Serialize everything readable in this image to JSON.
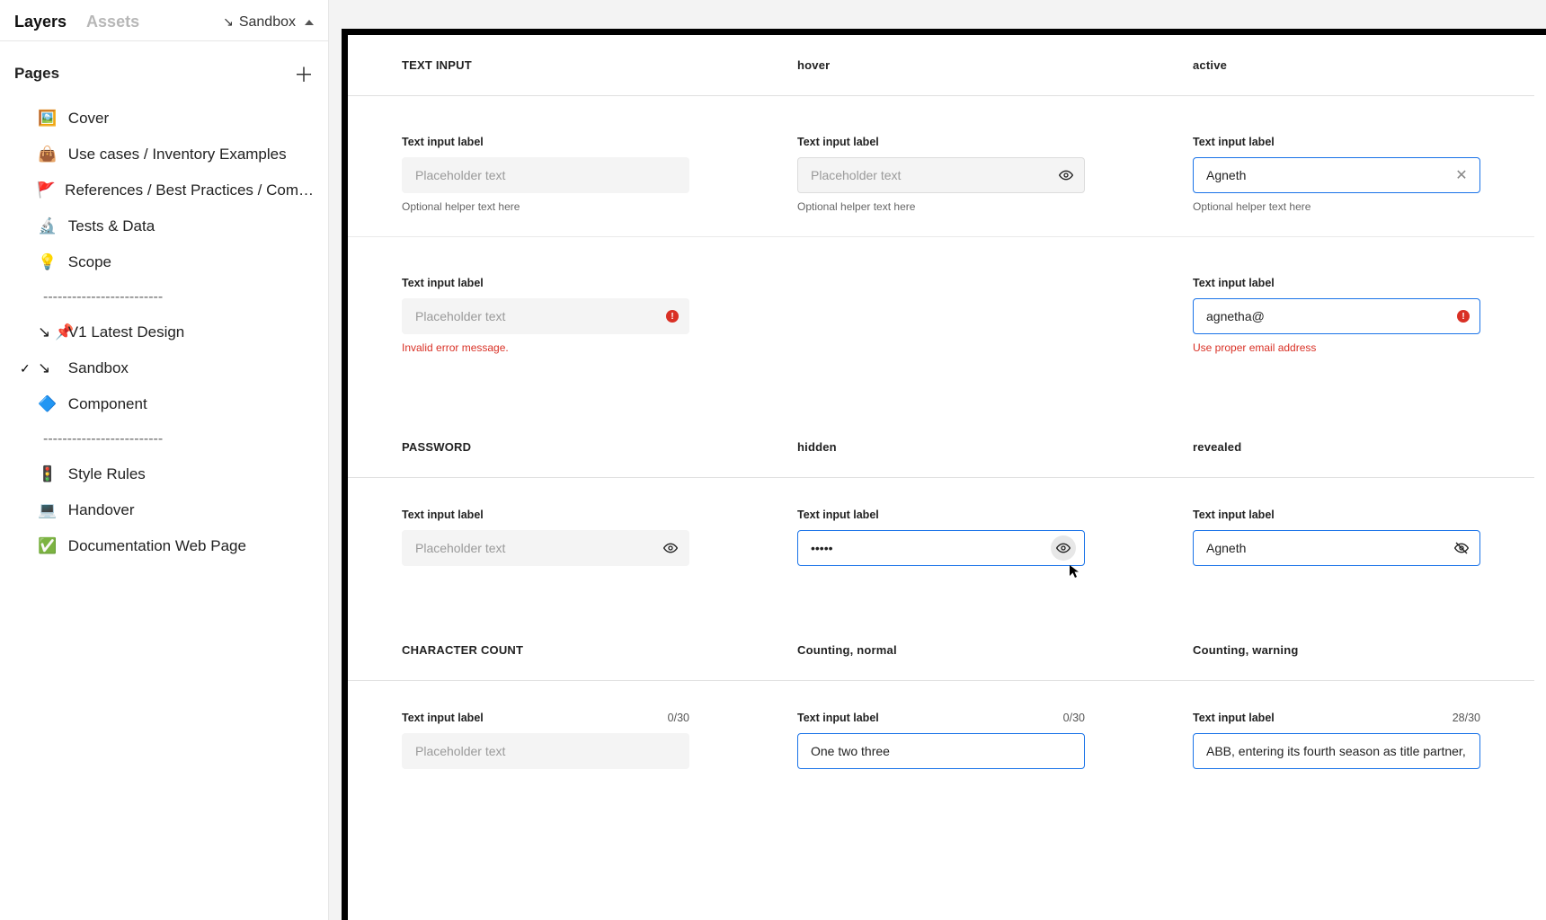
{
  "sidebar": {
    "tabs": {
      "layers": "Layers",
      "assets": "Assets"
    },
    "file_switcher": {
      "arrow": "↘",
      "label": "Sandbox"
    },
    "pages_label": "Pages",
    "pages": [
      {
        "emoji": "🖼️",
        "label": "Cover"
      },
      {
        "emoji": "👜",
        "label": "Use cases / Inventory Examples"
      },
      {
        "emoji": "🚩",
        "label": "References  / Best Practices / Com…"
      },
      {
        "emoji": "🔬",
        "label": "Tests & Data"
      },
      {
        "emoji": "💡",
        "label": "Scope"
      },
      {
        "emoji": "",
        "label": "-------------------------"
      },
      {
        "emoji": "↘ 📌",
        "label": "V1  Latest Design"
      },
      {
        "emoji": "↘",
        "label": "Sandbox",
        "current": true
      },
      {
        "emoji": "🔷",
        "label": "Component"
      },
      {
        "emoji": "",
        "label": "-------------------------"
      },
      {
        "emoji": "🚦",
        "label": "Style Rules"
      },
      {
        "emoji": "💻",
        "label": "Handover"
      },
      {
        "emoji": "✅",
        "label": "Documentation Web Page"
      }
    ]
  },
  "canvas": {
    "sections": {
      "text_input": {
        "heading_default": "TEXT INPUT",
        "heading_hover": "hover",
        "heading_active": "active",
        "default": {
          "label": "Text input label",
          "placeholder": "Placeholder text",
          "helper": "Optional helper text here"
        },
        "hover": {
          "label": "Text input label",
          "placeholder": "Placeholder text",
          "helper": "Optional helper text here"
        },
        "active": {
          "label": "Text input label",
          "value": "Agneth",
          "helper": "Optional helper text here"
        },
        "error_default": {
          "label": "Text input label",
          "placeholder": "Placeholder text",
          "error": "Invalid error message."
        },
        "error_active": {
          "label": "Text input label",
          "value": "agnetha@",
          "error": "Use proper email address"
        }
      },
      "password": {
        "heading_default": "PASSWORD",
        "heading_hidden": "hidden",
        "heading_revealed": "revealed",
        "default": {
          "label": "Text input label",
          "placeholder": "Placeholder text"
        },
        "hidden": {
          "label": "Text input label",
          "value_dots": "•••••"
        },
        "revealed": {
          "label": "Text input label",
          "value": "Agneth"
        }
      },
      "char_count": {
        "heading_default": "CHARACTER COUNT",
        "heading_normal": "Counting, normal",
        "heading_warning": "Counting, warning",
        "default": {
          "label": "Text input label",
          "counter": "0/30",
          "placeholder": "Placeholder text"
        },
        "normal": {
          "label": "Text input label",
          "counter": "0/30",
          "value": "One two three"
        },
        "warning": {
          "label": "Text input label",
          "counter": "28/30",
          "value": "ABB, entering its fourth season as title partner, is conti"
        }
      }
    }
  }
}
